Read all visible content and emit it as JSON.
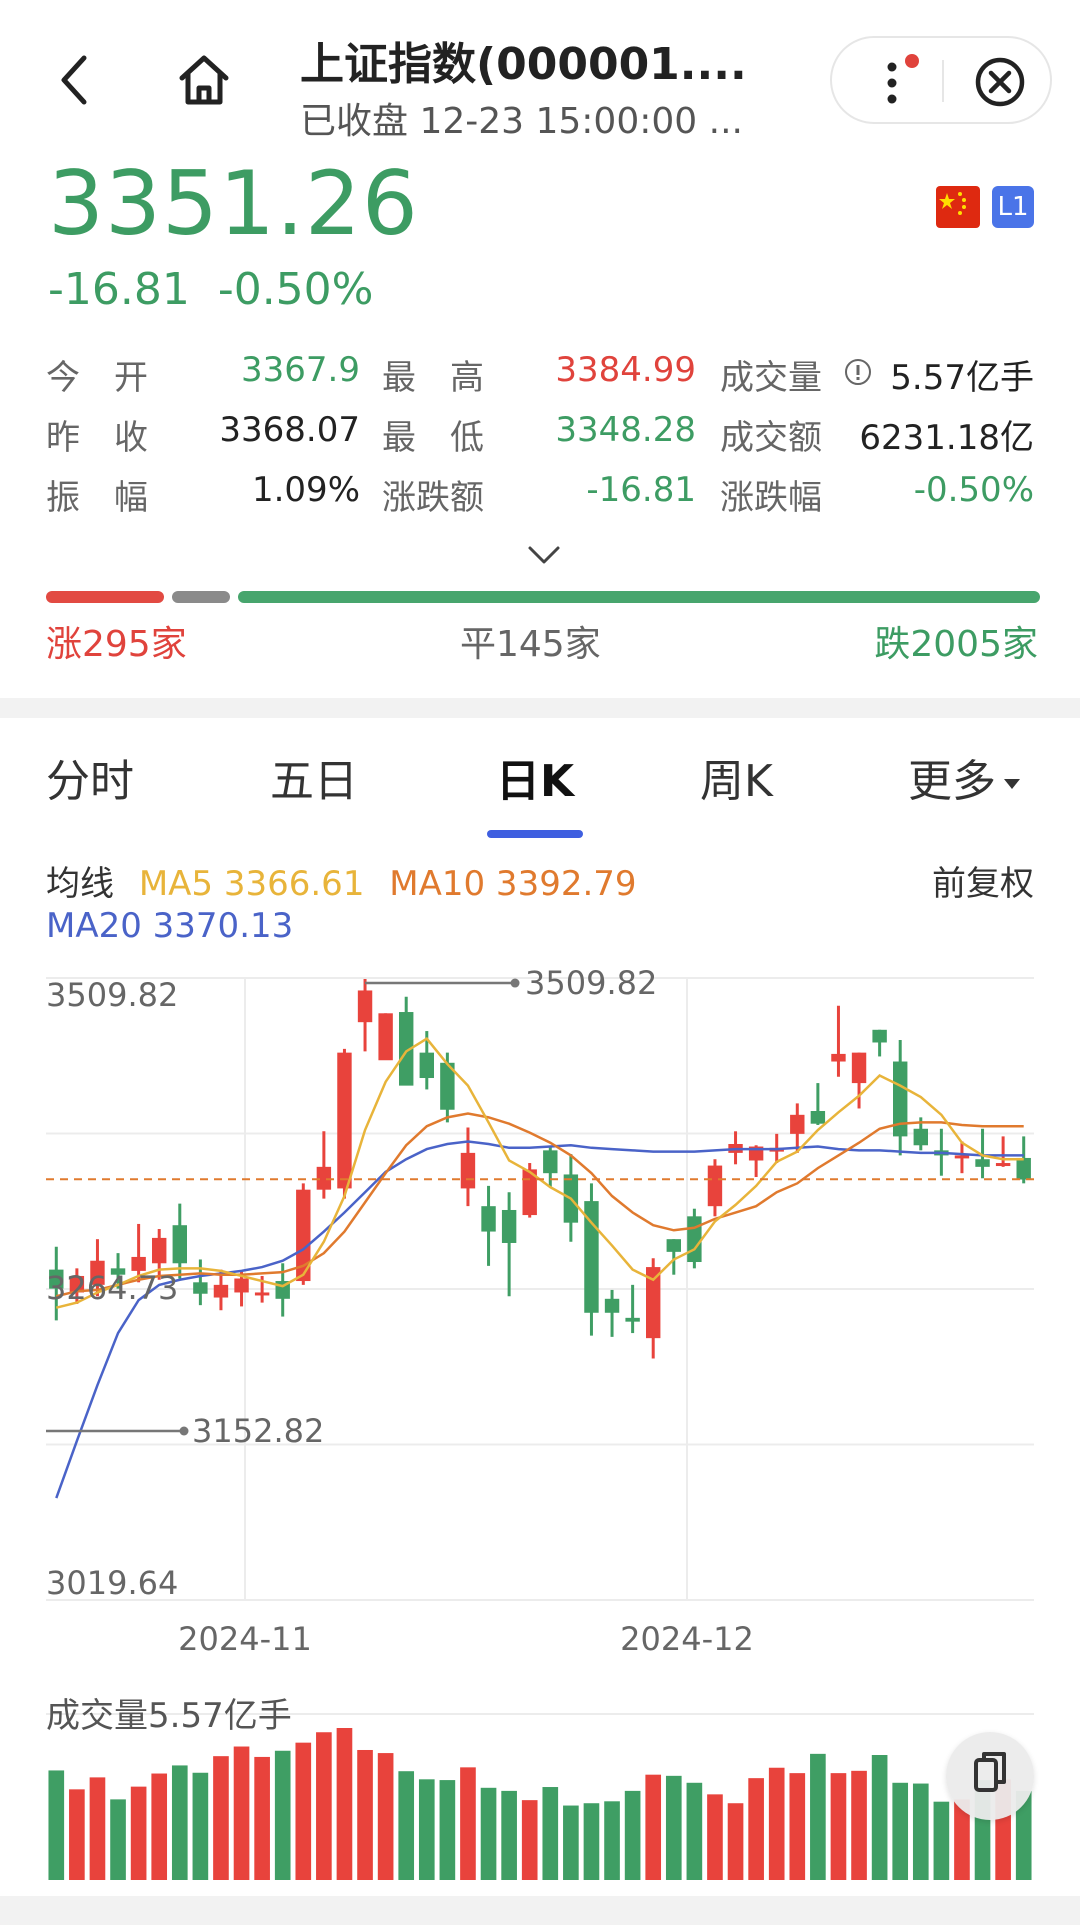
{
  "header": {
    "title": "上证指数(000001....",
    "subtitle": "已收盘 12-23 15:00:00 ...",
    "back_icon": "chevron-left-icon",
    "home_icon": "home-icon",
    "more_icon": "more-vertical-icon",
    "close_icon": "close-circle-icon"
  },
  "quote": {
    "price": "3351.26",
    "change": "-16.81",
    "change_pct": "-0.50%",
    "badge_l1": "L1",
    "flag_icon": "china-flag-icon"
  },
  "stats": [
    {
      "label": "今 开",
      "value": "3367.9",
      "color": "g"
    },
    {
      "label": "最 高",
      "value": "3384.99",
      "color": "r"
    },
    {
      "label": "成交量",
      "value": "5.57亿手",
      "color": "n",
      "info": true
    },
    {
      "label": "昨 收",
      "value": "3368.07",
      "color": "n"
    },
    {
      "label": "最 低",
      "value": "3348.28",
      "color": "g"
    },
    {
      "label": "成交额",
      "value": "6231.18亿",
      "color": "n"
    },
    {
      "label": "振 幅",
      "value": "1.09%",
      "color": "n"
    },
    {
      "label": "涨跌额",
      "value": "-16.81",
      "color": "g"
    },
    {
      "label": "涨跌幅",
      "value": "-0.50%",
      "color": "g"
    }
  ],
  "breadth": {
    "up_label": "涨295家",
    "flat_label": "平145家",
    "down_label": "跌2005家",
    "up": 295,
    "flat": 145,
    "down": 2005
  },
  "tabs": [
    {
      "label": "分时",
      "active": false
    },
    {
      "label": "五日",
      "active": false
    },
    {
      "label": "日K",
      "active": true
    },
    {
      "label": "周K",
      "active": false
    },
    {
      "label": "更多",
      "active": false
    }
  ],
  "ma": {
    "label": "均线",
    "ma5": "MA5 3366.61",
    "ma10": "MA10 3392.79",
    "ma20": "MA20 3370.13",
    "adjust": "前复权"
  },
  "chart_data": {
    "type": "candlestick",
    "y_labels": [
      "3509.82",
      "3264.73",
      "3019.64"
    ],
    "ylim": [
      3019.64,
      3509.82
    ],
    "x_labels": [
      "2024-11",
      "2024-12"
    ],
    "high_marker": "3509.82",
    "low_marker": "3152.82",
    "last_close": 3351.26,
    "candles": [
      [
        3280,
        3265,
        3298,
        3240
      ],
      [
        3262,
        3275,
        3281,
        3253
      ],
      [
        3268,
        3287,
        3304,
        3259
      ],
      [
        3281,
        3276,
        3293,
        3265
      ],
      [
        3279,
        3290,
        3316,
        3270
      ],
      [
        3285,
        3305,
        3312,
        3272
      ],
      [
        3315,
        3285,
        3332,
        3273
      ],
      [
        3270,
        3261,
        3288,
        3252
      ],
      [
        3258,
        3268,
        3280,
        3248
      ],
      [
        3262,
        3273,
        3279,
        3251
      ],
      [
        3262,
        3262,
        3275,
        3254
      ],
      [
        3271,
        3257,
        3285,
        3243
      ],
      [
        3271,
        3343,
        3348,
        3268
      ],
      [
        3343,
        3361,
        3389,
        3336
      ],
      [
        3344,
        3451,
        3454,
        3336
      ],
      [
        3475,
        3500,
        3509,
        3452
      ],
      [
        3445,
        3482,
        3482,
        3454
      ],
      [
        3483,
        3425,
        3495,
        3437
      ],
      [
        3451,
        3431,
        3468,
        3422
      ],
      [
        3443,
        3406,
        3451,
        3396
      ],
      [
        3344,
        3372,
        3392,
        3330
      ],
      [
        3330,
        3310,
        3346,
        3283
      ],
      [
        3327,
        3301,
        3341,
        3259
      ],
      [
        3323,
        3359,
        3364,
        3321
      ],
      [
        3374,
        3356,
        3377,
        3345
      ],
      [
        3355,
        3317,
        3371,
        3302
      ],
      [
        3334,
        3246,
        3348,
        3228
      ],
      [
        3257,
        3246,
        3264,
        3227
      ],
      [
        3242,
        3239,
        3268,
        3230
      ],
      [
        3226,
        3282,
        3289,
        3210
      ],
      [
        3304,
        3294,
        3304,
        3276
      ],
      [
        3322,
        3286,
        3328,
        3281
      ],
      [
        3330,
        3362,
        3367,
        3322
      ],
      [
        3372,
        3379,
        3389,
        3363
      ],
      [
        3366,
        3377,
        3378,
        3353
      ],
      [
        3373,
        3376,
        3387,
        3364
      ],
      [
        3387,
        3402,
        3411,
        3372
      ],
      [
        3405,
        3395,
        3427,
        3394
      ],
      [
        3444,
        3450,
        3488,
        3432
      ],
      [
        3427,
        3451,
        3451,
        3407
      ],
      [
        3469,
        3459,
        3469,
        3448
      ],
      [
        3444,
        3385,
        3461,
        3370
      ],
      [
        3391,
        3378,
        3400,
        3374
      ],
      [
        3374,
        3370,
        3391,
        3354
      ],
      [
        3370,
        3370,
        3381,
        3356
      ],
      [
        3367,
        3361,
        3391,
        3352
      ],
      [
        3364,
        3364,
        3385,
        3361
      ],
      [
        3368,
        3351,
        3385,
        3348
      ]
    ],
    "ma5": [
      3250,
      3254,
      3262,
      3268,
      3275,
      3280,
      3281,
      3281,
      3279,
      3275,
      3271,
      3267,
      3276,
      3302,
      3338,
      3390,
      3428,
      3452,
      3462,
      3442,
      3425,
      3396,
      3366,
      3357,
      3345,
      3336,
      3317,
      3299,
      3280,
      3272,
      3288,
      3296,
      3318,
      3331,
      3346,
      3365,
      3373,
      3390,
      3404,
      3417,
      3433,
      3425,
      3416,
      3402,
      3380,
      3370,
      3367,
      3367
    ],
    "ma10": [
      3259,
      3263,
      3264,
      3268,
      3272,
      3275,
      3276,
      3277,
      3276,
      3276,
      3277,
      3278,
      3283,
      3293,
      3310,
      3333,
      3356,
      3378,
      3393,
      3400,
      3403,
      3400,
      3395,
      3388,
      3380,
      3370,
      3356,
      3338,
      3325,
      3315,
      3311,
      3313,
      3320,
      3325,
      3330,
      3341,
      3348,
      3360,
      3370,
      3380,
      3391,
      3395,
      3396,
      3396,
      3394,
      3393,
      3393,
      3393
    ],
    "ma20": [
      3100,
      3145,
      3189,
      3230,
      3256,
      3268,
      3272,
      3275,
      3277,
      3279,
      3282,
      3287,
      3296,
      3310,
      3325,
      3341,
      3357,
      3367,
      3375,
      3379,
      3381,
      3379,
      3376,
      3376,
      3377,
      3378,
      3376,
      3375,
      3374,
      3373,
      3373,
      3373,
      3374,
      3375,
      3375,
      3375,
      3376,
      3377,
      3375,
      3374,
      3374,
      3373,
      3372,
      3372,
      3371,
      3370,
      3370,
      3370
    ]
  },
  "volume": {
    "label": "成交量5.57亿手",
    "values": [
      2.84,
      2.35,
      2.66,
      2.09,
      2.42,
      2.76,
      2.97,
      2.78,
      3.21,
      3.46,
      3.19,
      3.35,
      3.56,
      3.83,
      3.94,
      3.37,
      3.29,
      2.82,
      2.61,
      2.59,
      2.92,
      2.39,
      2.31,
      2.07,
      2.41,
      1.93,
      1.99,
      2.04,
      2.31,
      2.73,
      2.7,
      2.52,
      2.22,
      1.99,
      2.64,
      2.91,
      2.77,
      3.27,
      2.77,
      2.83,
      3.24,
      2.52,
      2.5,
      2.03,
      2.09,
      2.59,
      2.61,
      2.31
    ],
    "vmax": 3.94,
    "copy_icon": "copy-float-icon"
  }
}
